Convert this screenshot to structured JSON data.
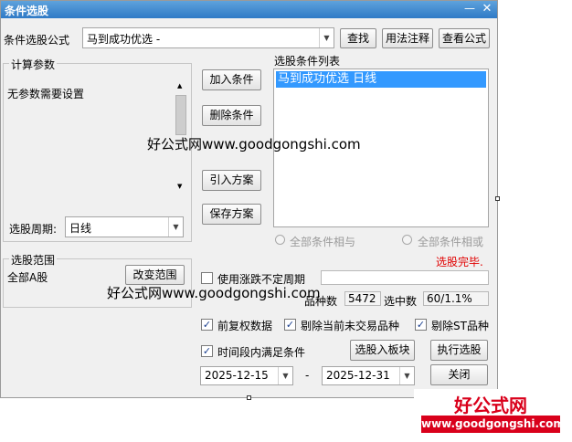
{
  "window": {
    "title": "条件选股",
    "minimize_glyph": "—",
    "close_glyph": "✕"
  },
  "formula": {
    "label": "条件选股公式",
    "value": "马到成功优选  -",
    "find_label": "查找",
    "usage_label": "用法注释",
    "view_label": "查看公式"
  },
  "params": {
    "group_title": "计算参数",
    "message": "无参数需要设置",
    "period_label": "选股周期:",
    "period_value": "日线"
  },
  "buttons": {
    "add": "加入条件",
    "delete": "删除条件",
    "import": "引入方案",
    "save": "保存方案",
    "change_range": "改变范围",
    "to_block": "选股入板块",
    "execute": "执行选股",
    "close": "关闭"
  },
  "conditions": {
    "title": "选股条件列表",
    "items": [
      "马到成功优选  日线"
    ],
    "radio_and": "全部条件相与",
    "radio_or": "全部条件相或"
  },
  "status": {
    "message": "选股完毕.",
    "color": "#e00000"
  },
  "range": {
    "group_title": "选股范围",
    "value": "全部A股"
  },
  "options": {
    "use_zdf": "使用涨跌不定周期",
    "pin_label": "品种数",
    "pin_value": "5472",
    "sel_label": "选中数",
    "sel_value": "60/1.1%",
    "qfq": "前复权数据",
    "exclude_untraded": "剔除当前未交易品种",
    "exclude_st": "剔除ST品种",
    "time_period": "时间段内满足条件"
  },
  "dates": {
    "start": "2025-12-15",
    "separator": "-",
    "end": "2025-12-31"
  },
  "watermark": {
    "text1": "好公式网www.goodgongshi.com",
    "text2": "好公式网www.goodgongshi.com",
    "logo_cn": "好公式网",
    "logo_url": "www.goodgongshi.com",
    "logo_color": "#d9001b"
  },
  "checks": {
    "use_zdf": false,
    "qfq": true,
    "exclude_untraded": true,
    "exclude_st": true,
    "time_period": true
  }
}
